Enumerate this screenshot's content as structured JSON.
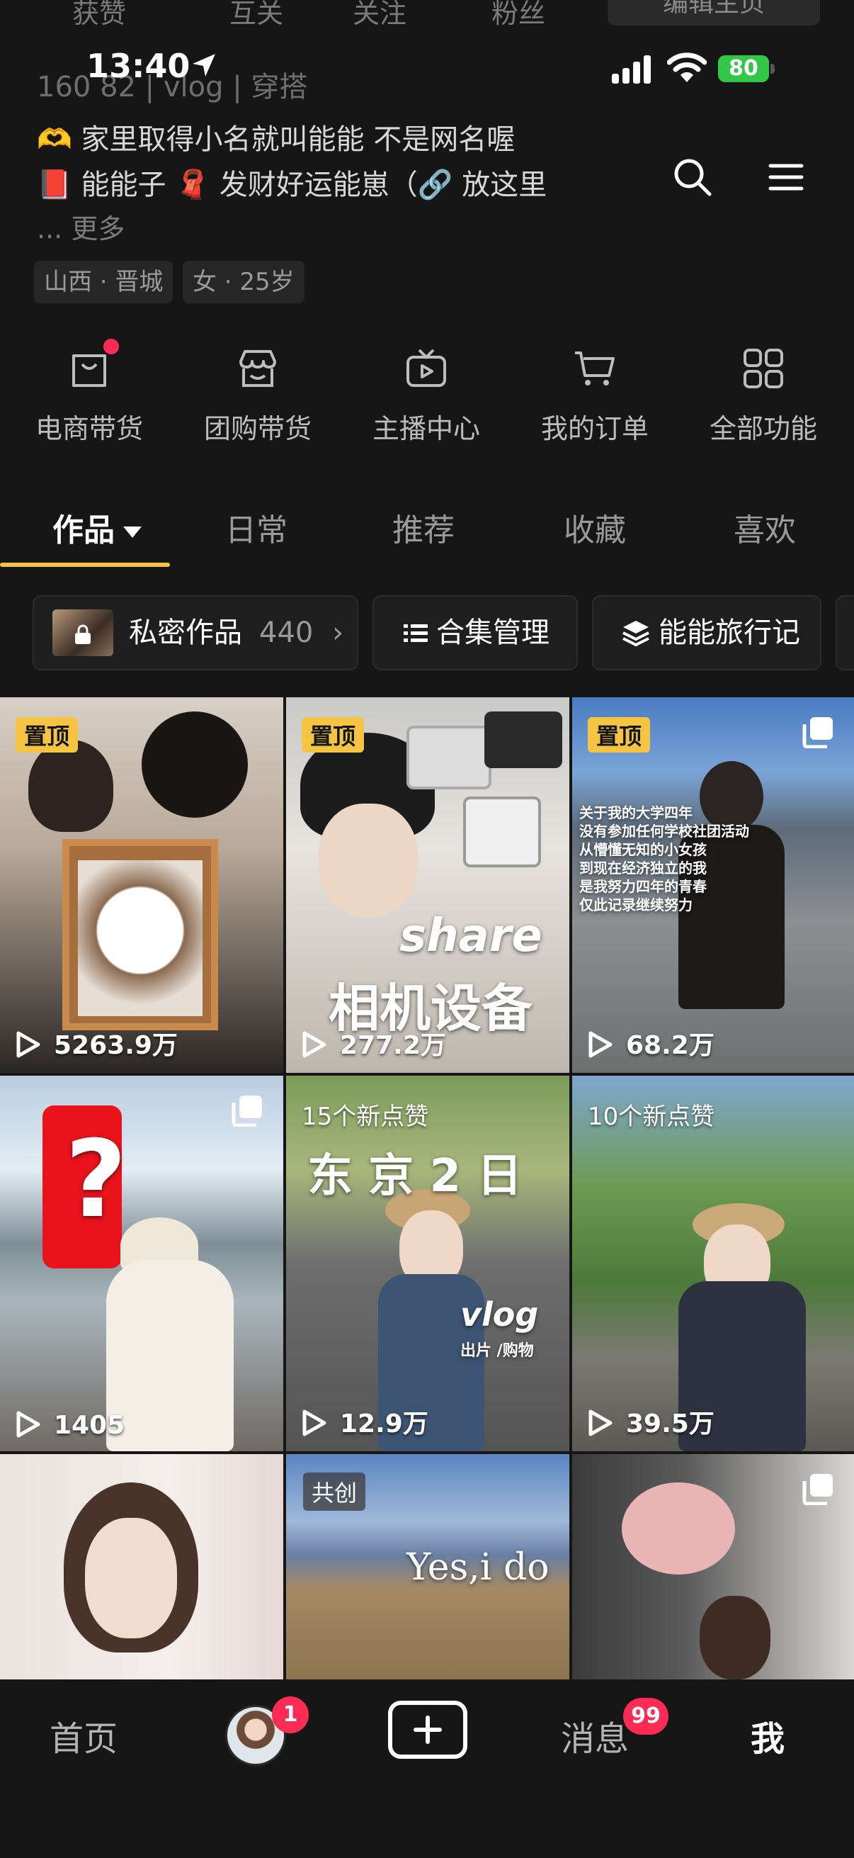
{
  "stats": [
    "获赞",
    "互关",
    "关注",
    "粉丝"
  ],
  "edit_profile": "编辑主页",
  "status": {
    "time": "13:40",
    "battery": "80"
  },
  "bio": {
    "line0": "160 82 | vlog | 穿搭",
    "line1": "🫶 家里取得小名就叫能能 不是网名喔",
    "line2": "📕 能能子 🧣 发财好运能崽（🔗 放这里",
    "more": "... 更多"
  },
  "tags": [
    "山西 · 晋城",
    "女 · 25岁"
  ],
  "functions": [
    {
      "label": "电商带货",
      "icon": "shopping-bag-icon"
    },
    {
      "label": "团购带货",
      "icon": "store-icon"
    },
    {
      "label": "主播中心",
      "icon": "tv-play-icon"
    },
    {
      "label": "我的订单",
      "icon": "cart-icon"
    },
    {
      "label": "全部功能",
      "icon": "grid-apps-icon"
    }
  ],
  "tabs": [
    "作品",
    "日常",
    "推荐",
    "收藏",
    "喜欢"
  ],
  "collections": {
    "private_label": "私密作品",
    "private_count": "440",
    "manage_label": "合集管理",
    "travel_label": "能能旅行记"
  },
  "videos": [
    {
      "badge": "置顶",
      "plays": "5263.9万"
    },
    {
      "badge": "置顶",
      "plays": "277.2万",
      "overlay1": "share",
      "overlay2": "相机设备"
    },
    {
      "badge": "置顶",
      "plays": "68.2万",
      "caption": [
        "关于我的大学四年",
        "没有参加任何学校社团活动",
        "从懵懂无知的小女孩",
        "到现在经济独立的我",
        "是我努力四年的青春",
        "仅此记录继续努力"
      ]
    },
    {
      "plays": "1405",
      "overlay1": "?"
    },
    {
      "likes": "15个新点赞",
      "plays": "12.9万",
      "overlay1": "东 京 2 日",
      "overlay2": "vlog",
      "overlay3": "出片 /购物"
    },
    {
      "likes": "10个新点赞",
      "plays": "39.5万"
    },
    {},
    {
      "badge": "共创",
      "overlay1": "Yes,i do"
    },
    {}
  ],
  "bottom_nav": {
    "home": "首页",
    "messages": "消息",
    "me": "我",
    "friends_badge": "1",
    "messages_badge": "99"
  },
  "colors": {
    "accent": "#f5c443",
    "badge_red": "#fe2c55",
    "background": "#161616"
  }
}
